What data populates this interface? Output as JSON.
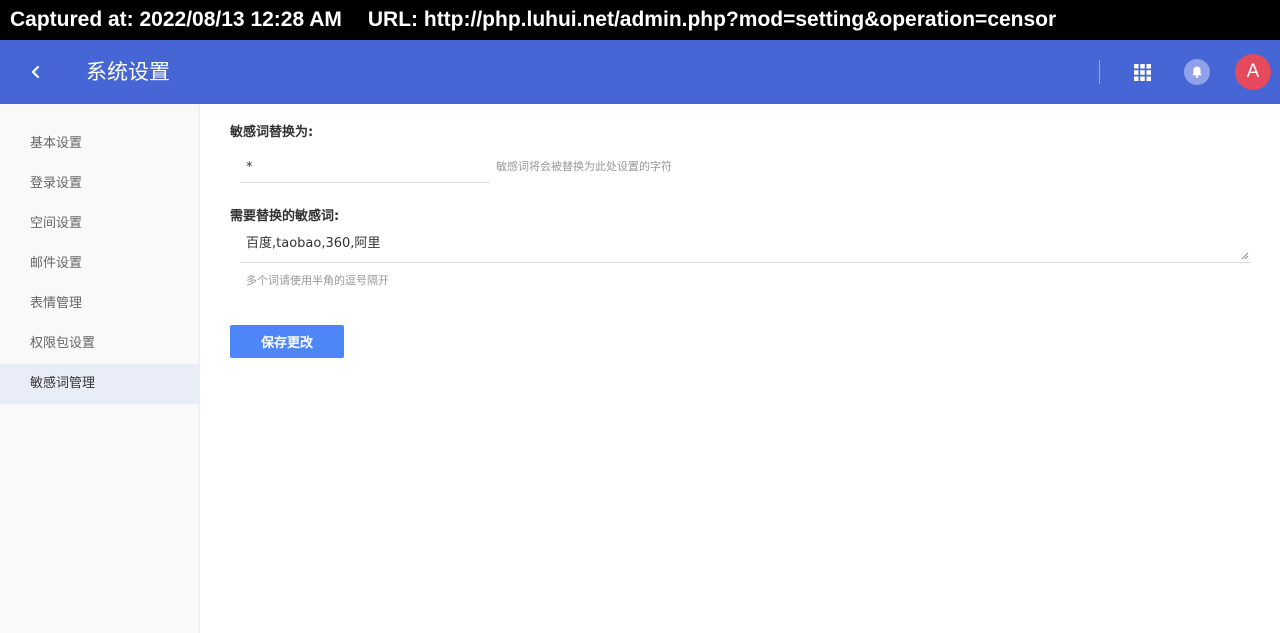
{
  "capture": {
    "captured_at": "Captured at: 2022/08/13 12:28 AM",
    "url": "URL: http://php.luhui.net/admin.php?mod=setting&operation=censor"
  },
  "header": {
    "title": "系统设置",
    "avatar_letter": "A",
    "icons": [
      "chevron-left-icon",
      "apps-grid-icon",
      "bell-icon"
    ]
  },
  "sidebar": {
    "items": [
      {
        "label": "基本设置",
        "active": false
      },
      {
        "label": "登录设置",
        "active": false
      },
      {
        "label": "空间设置",
        "active": false
      },
      {
        "label": "邮件设置",
        "active": false
      },
      {
        "label": "表情管理",
        "active": false
      },
      {
        "label": "权限包设置",
        "active": false
      },
      {
        "label": "敏感词管理",
        "active": true
      }
    ]
  },
  "form": {
    "replace": {
      "label": "敏感词替换为:",
      "value": "*",
      "help": "敏感词将会被替换为此处设置的字符"
    },
    "words": {
      "label": "需要替换的敏感词:",
      "value": "百度,taobao,360,阿里",
      "help": "多个词请使用半角的逗号隔开"
    },
    "save_label": "保存更改"
  },
  "colors": {
    "header_bg": "#4666d6",
    "primary_button": "#4c86f7",
    "avatar_bg": "#e54b5d",
    "sidebar_active_bg": "#e8edf8"
  }
}
